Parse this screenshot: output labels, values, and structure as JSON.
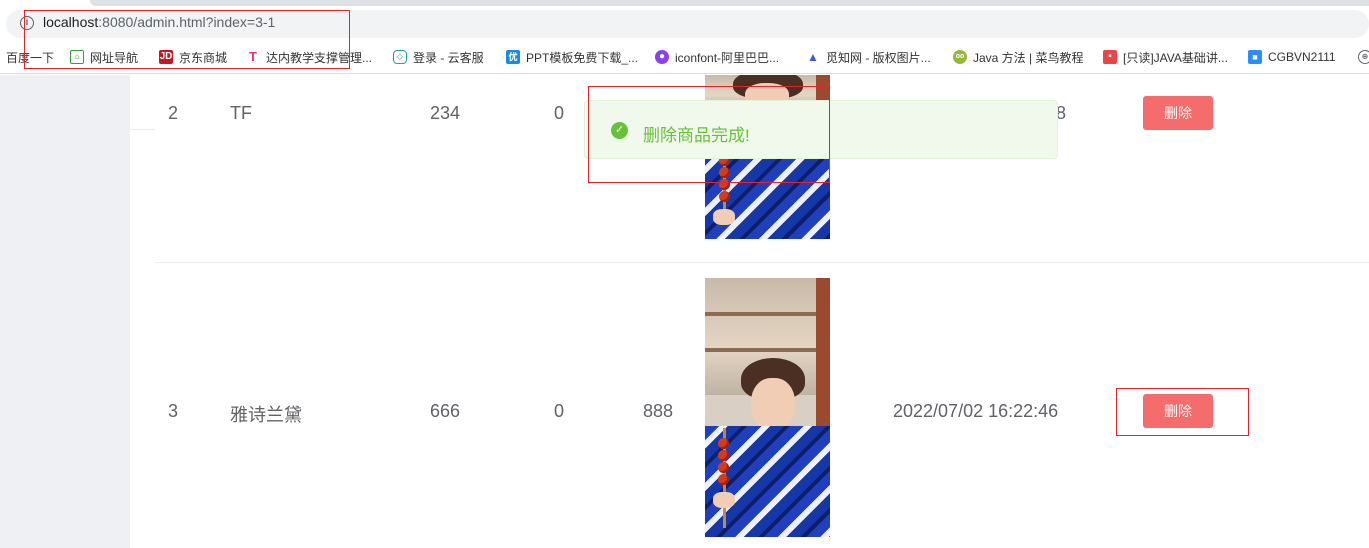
{
  "browser": {
    "url_host": "localhost",
    "url_rest": ":8080/admin.html?index=3-1",
    "bookmarks": [
      {
        "label": "百度一下",
        "icon": "none"
      },
      {
        "label": "网址导航",
        "icon": "2345-nav-icon"
      },
      {
        "label": "京东商城",
        "icon": "jd-icon"
      },
      {
        "label": "达内教学支撑管理...",
        "icon": "tarena-icon"
      },
      {
        "label": "登录 - 云客服",
        "icon": "cloud-service-icon"
      },
      {
        "label": "PPT模板免费下载_...",
        "icon": "ppt-icon"
      },
      {
        "label": "iconfont-阿里巴巴...",
        "icon": "iconfont-icon"
      },
      {
        "label": "觅知网 - 版权图片...",
        "icon": "mizhi-icon"
      },
      {
        "label": "Java 方法 | 菜鸟教程",
        "icon": "runoob-icon"
      },
      {
        "label": "[只读]JAVA基础讲...",
        "icon": "doc-icon"
      },
      {
        "label": "CGBVN2111",
        "icon": "zoom-icon"
      }
    ]
  },
  "table": {
    "rows": [
      {
        "id": "2",
        "name": "TF",
        "price": "234",
        "col4": "0",
        "col5": "",
        "time": "",
        "time_tail": "8",
        "delete_label": "删除"
      },
      {
        "id": "3",
        "name": "雅诗兰黛",
        "price": "666",
        "col4": "0",
        "col5": "888",
        "time": "2022/07/02 16:22:46",
        "delete_label": "删除"
      }
    ]
  },
  "toast": {
    "message": "删除商品完成!",
    "color": "#67c23a",
    "icon": "check-circle-icon"
  },
  "colors": {
    "danger": "#f56c6c",
    "success": "#67c23a",
    "annotation": "#e0252b"
  }
}
